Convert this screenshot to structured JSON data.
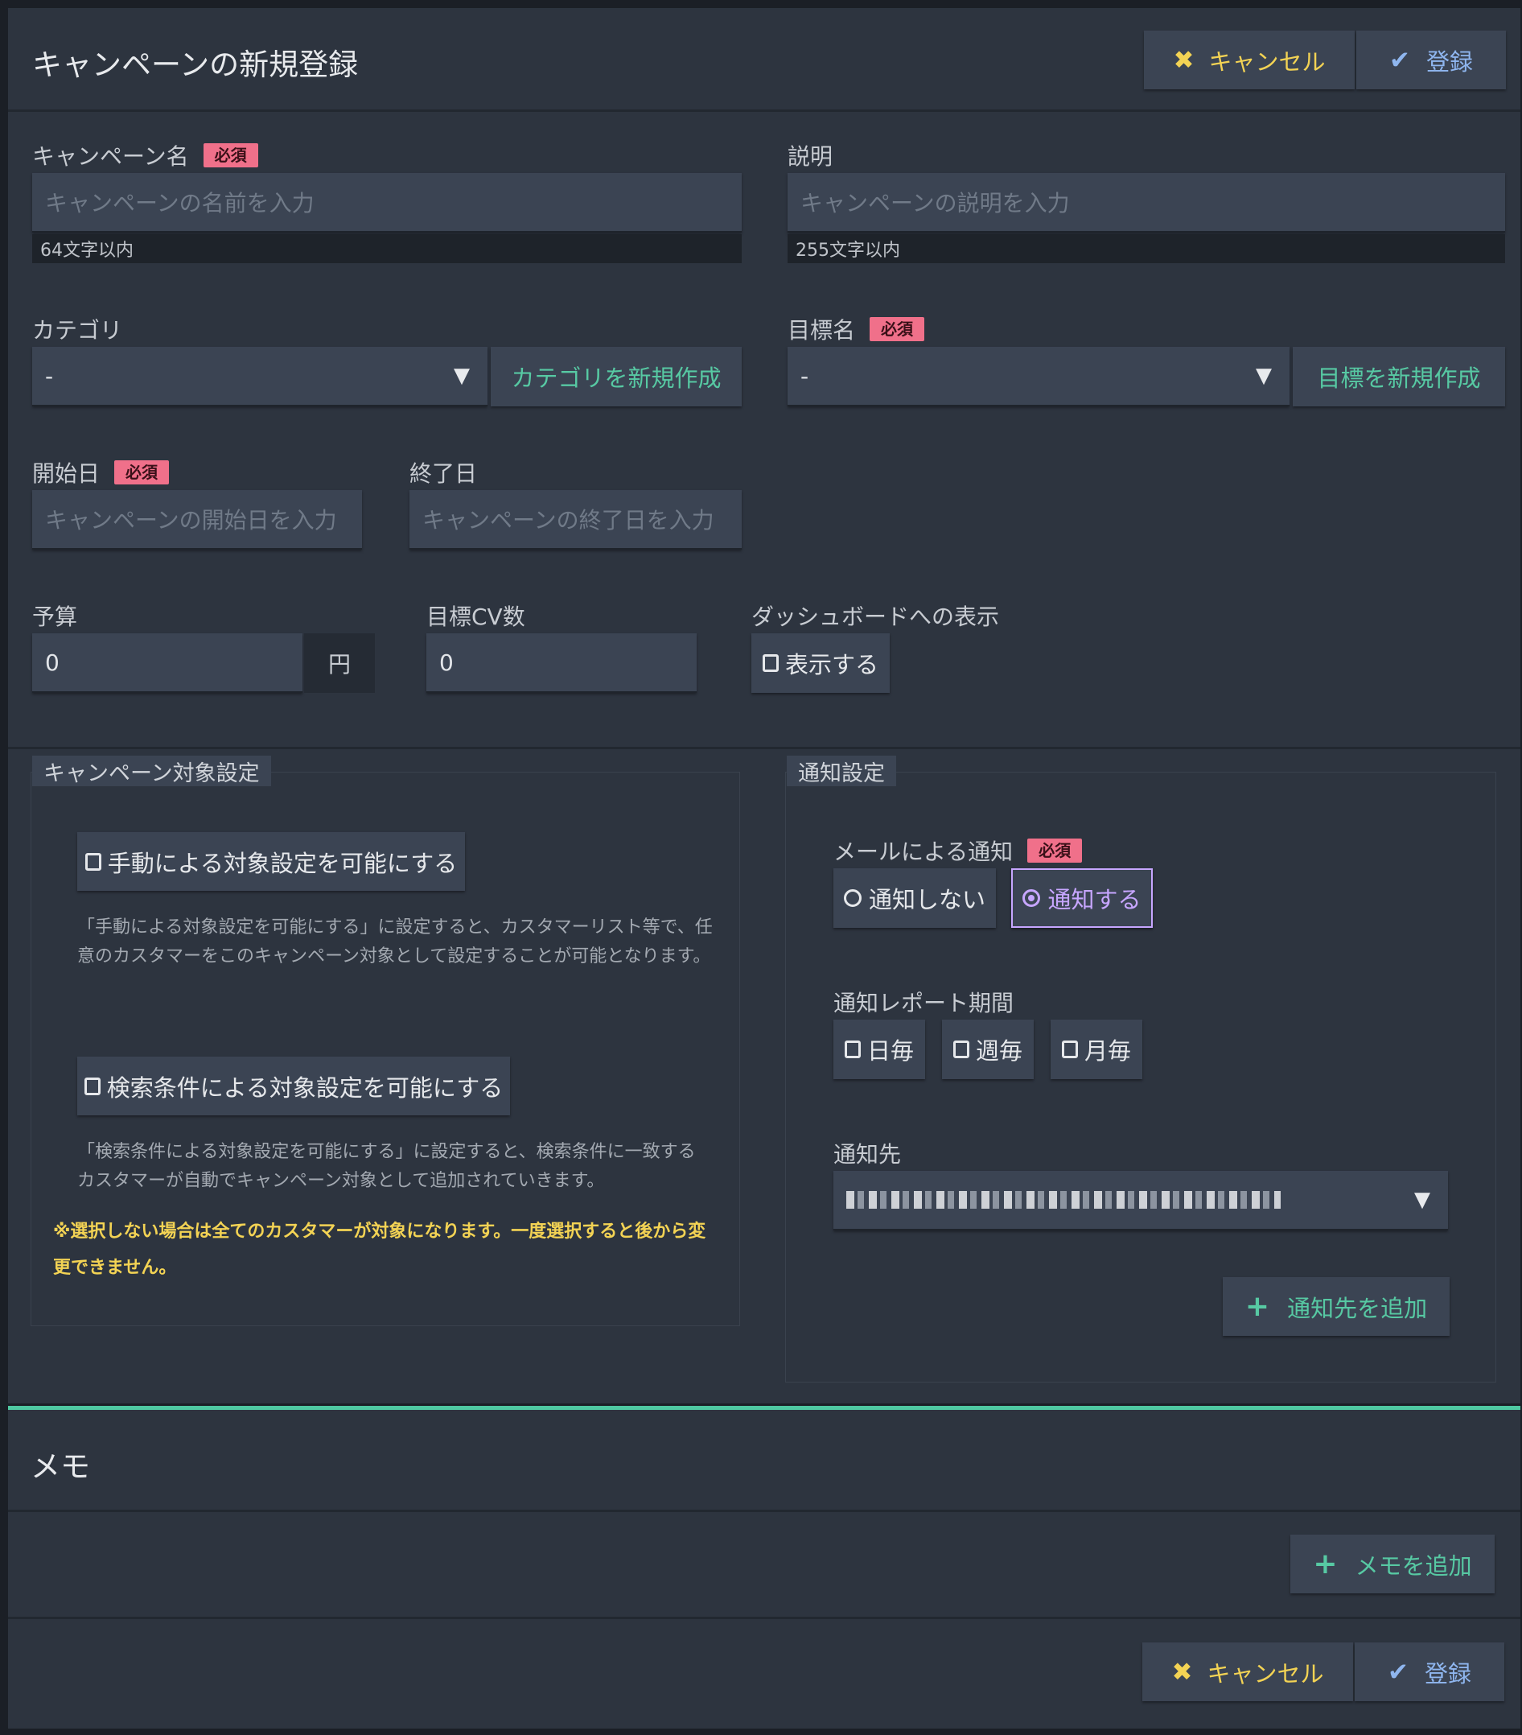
{
  "header": {
    "title": "キャンペーンの新規登録",
    "cancel_label": "キャンセル",
    "register_label": "登録"
  },
  "form": {
    "name": {
      "label": "キャンペーン名",
      "required": "必須",
      "placeholder": "キャンペーンの名前を入力",
      "hint": "64文字以内"
    },
    "description": {
      "label": "説明",
      "placeholder": "キャンペーンの説明を入力",
      "hint": "255文字以内"
    },
    "category": {
      "label": "カテゴリ",
      "value": "-",
      "new_button": "カテゴリを新規作成"
    },
    "goal": {
      "label": "目標名",
      "required": "必須",
      "value": "-",
      "new_button": "目標を新規作成"
    },
    "start_date": {
      "label": "開始日",
      "required": "必須",
      "placeholder": "キャンペーンの開始日を入力"
    },
    "end_date": {
      "label": "終了日",
      "placeholder": "キャンペーンの終了日を入力"
    },
    "budget": {
      "label": "予算",
      "value": "0",
      "unit": "円"
    },
    "cv_target": {
      "label": "目標CV数",
      "value": "0"
    },
    "dashboard": {
      "label": "ダッシュボードへの表示",
      "checkbox_label": "表示する"
    }
  },
  "target_settings": {
    "legend": "キャンペーン対象設定",
    "manual_label": "手動による対象設定を可能にする",
    "manual_desc": "「手動による対象設定を可能にする」に設定すると、カスタマーリスト等で、任意のカスタマーをこのキャンペーン対象として設定することが可能となります。",
    "search_label": "検索条件による対象設定を可能にする",
    "search_desc": "「検索条件による対象設定を可能にする」に設定すると、検索条件に一致するカスタマーが自動でキャンペーン対象として追加されていきます。",
    "warning": "※選択しない場合は全てのカスタマーが対象になります。一度選択すると後から変更できません。"
  },
  "notification": {
    "legend": "通知設定",
    "mail_label": "メールによる通知",
    "required": "必須",
    "option_off": "通知しない",
    "option_on": "通知する",
    "selected": "通知する",
    "period_label": "通知レポート期間",
    "period_daily": "日毎",
    "period_weekly": "週毎",
    "period_monthly": "月毎",
    "recipient_label": "通知先",
    "add_recipient": "通知先を追加"
  },
  "memo": {
    "title": "メモ",
    "add_label": "メモを追加"
  },
  "footer": {
    "cancel_label": "キャンセル",
    "register_label": "登録"
  },
  "colors": {
    "accent": "#57c9a3",
    "required_badge": "#f0708a",
    "warning": "#f3d354",
    "panel": "#2d343f",
    "input": "#3b4453"
  }
}
